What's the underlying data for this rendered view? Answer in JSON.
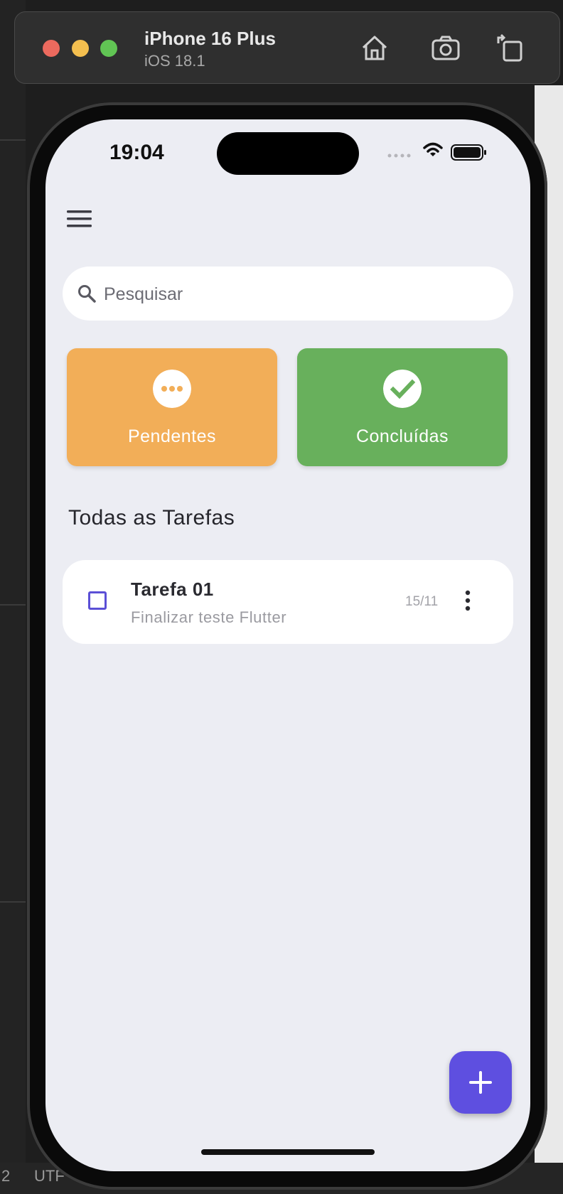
{
  "simulator": {
    "device_name": "iPhone 16 Plus",
    "os_version": "iOS 18.1",
    "buttons": [
      "home-icon",
      "screenshot-icon",
      "rotate-icon"
    ]
  },
  "background": {
    "left_text": "2",
    "bottom_text": "UTF"
  },
  "status_bar": {
    "time": "19:04",
    "icons": [
      "cellular-icon",
      "wifi-icon",
      "battery-icon"
    ]
  },
  "app": {
    "menu_icon": "menu-icon",
    "search": {
      "placeholder": "Pesquisar",
      "value": ""
    },
    "categories": [
      {
        "label": "Pendentes",
        "icon": "more-horiz-icon",
        "color": "#f2ae58"
      },
      {
        "label": "Concluídas",
        "icon": "check-circle-icon",
        "color": "#68b05c"
      }
    ],
    "section_title": "Todas as Tarefas",
    "tasks": [
      {
        "title": "Tarefa 01",
        "description": "Finalizar teste Flutter",
        "date": "15/11",
        "completed": false
      }
    ],
    "fab_icon": "add-icon",
    "accent_color": "#5e4fe0"
  }
}
